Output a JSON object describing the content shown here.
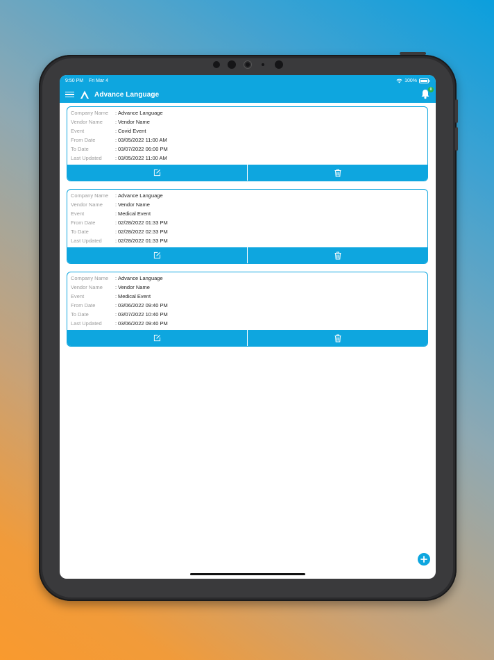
{
  "status_bar": {
    "time": "9:50 PM",
    "date": "Fri Mar 4",
    "battery": "100%"
  },
  "header": {
    "title": "Advance Language",
    "notification_count": "0"
  },
  "field_labels": {
    "company": "Company Name",
    "vendor": "Vendor Name",
    "event": "Event",
    "from": "From Date",
    "to": "To Date",
    "updated": "Last Updated",
    "separator": ":"
  },
  "events": [
    {
      "company": "Advance Language",
      "vendor": "Vendor Name",
      "event": "Covid Event",
      "from": "03/05/2022 11:00 AM",
      "to": "03/07/2022 06:00 PM",
      "updated": "03/05/2022 11:00 AM"
    },
    {
      "company": "Advance Language",
      "vendor": "Vendor Name",
      "event": "Medical Event",
      "from": "02/28/2022 01:33 PM",
      "to": "02/28/2022 02:33 PM",
      "updated": "02/28/2022 01:33 PM"
    },
    {
      "company": "Advance Language",
      "vendor": "Vendor Name",
      "event": "Medical Event",
      "from": "03/06/2022 09:40 PM",
      "to": "03/07/2022 10:40 PM",
      "updated": "03/06/2022 09:40 PM"
    }
  ],
  "icons": {
    "menu": "hamburger-menu-icon",
    "logo": "app-logo",
    "bell": "bell-icon",
    "edit": "edit-icon",
    "delete": "trash-icon",
    "add": "plus-icon"
  },
  "colors": {
    "primary": "#0ea6df",
    "badge": "#2fb34a"
  }
}
